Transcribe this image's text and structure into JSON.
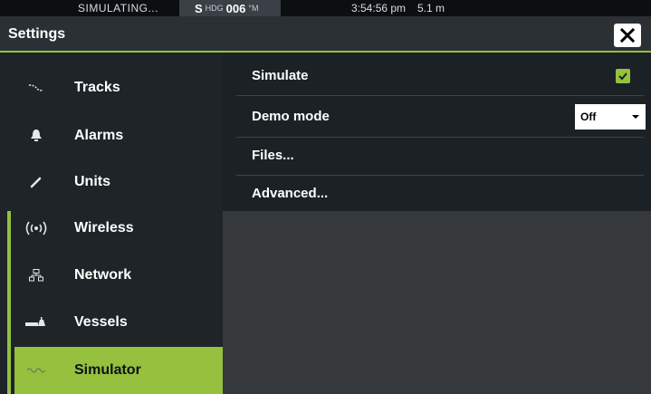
{
  "status_bar": {
    "simulating": "SIMULATING...",
    "heading_prefix": "S",
    "heading_label": "HDG",
    "heading_value": "006",
    "heading_unit": "°M",
    "time": "3:54:56 pm",
    "depth": "5.1 m"
  },
  "header": {
    "title": "Settings",
    "close_icon": "close-icon"
  },
  "sidebar": {
    "items": [
      {
        "label": "Tracks",
        "icon": "tracks-icon",
        "selected": false
      },
      {
        "label": "Alarms",
        "icon": "bell-icon",
        "selected": false
      },
      {
        "label": "Units",
        "icon": "pencil-icon",
        "selected": false
      },
      {
        "label": "Wireless",
        "icon": "wireless-icon",
        "selected": false
      },
      {
        "label": "Network",
        "icon": "network-icon",
        "selected": false
      },
      {
        "label": "Vessels",
        "icon": "vessels-icon",
        "selected": false
      },
      {
        "label": "Simulator",
        "icon": "simulator-icon",
        "selected": true
      }
    ]
  },
  "main": {
    "simulate": {
      "label": "Simulate",
      "checked": true
    },
    "demo_mode": {
      "label": "Demo mode",
      "value": "Off"
    },
    "files": {
      "label": "Files..."
    },
    "advanced": {
      "label": "Advanced..."
    }
  },
  "colors": {
    "accent": "#95c13e",
    "background": "#161b1f",
    "panel": "#35393c"
  }
}
